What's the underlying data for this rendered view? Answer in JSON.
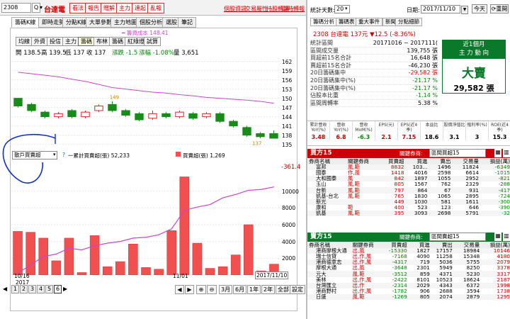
{
  "left": {
    "stock_code": "2308",
    "stock_name": "台達電",
    "red_tabs": [
      "看法",
      "報告",
      "贈解",
      "主力",
      "達起",
      "亂報"
    ],
    "top_links": [
      "個股資訊",
      "交易屬性",
      "持股轉讓",
      "即時轉報"
    ],
    "main_tabs": [
      "籌碼K線",
      "即時走勢",
      "分點K線",
      "大單參數",
      "主力地圖",
      "個股分析",
      "選股",
      "筆記"
    ],
    "sub_tabs": [
      "均線",
      "外資",
      "投信",
      "主力",
      "籌碼",
      "布林",
      "籌碼",
      "紅綠燈",
      "試算"
    ],
    "legend_line": "籌資成本 148.41",
    "ohlc": {
      "open": "開 138.5",
      "high": "高 139.5",
      "low": "低 137",
      "close": "收 137",
      "change": "漲跌 -1.5",
      "pct": "漲幅 -1.08%",
      "volume": "量 3,651"
    },
    "price_axis": [
      "162",
      "159",
      "156",
      "153",
      "150",
      "147",
      "144",
      "141",
      "138",
      "135"
    ],
    "candle_labels": {
      "hi": "149",
      "lo": "137"
    },
    "indicator_select": "散戶買賣超",
    "indicator_legend": {
      "a": "一累計買賣超(張) 52,233",
      "b": "買賣超(張) 1,269"
    },
    "indicator_value": "-361.4",
    "vol_axis": [
      "10000",
      "8000",
      "6000",
      "4000",
      "2000",
      "0"
    ],
    "x_labels": {
      "a": "10/16",
      "year": "2017",
      "b": "11/01",
      "c": "2017/11/10"
    },
    "pages": [
      "1",
      "2",
      "3",
      "4",
      "5",
      "6"
    ],
    "zoom_buttons": [
      "3月",
      "6月",
      "1年",
      "2年",
      "全部",
      "設定"
    ]
  },
  "right": {
    "stat_days_label": "統計天數:",
    "stat_days": "20",
    "date_label": "日期:",
    "date": "2017/11/10",
    "today_btn": "今天",
    "reload_btn": "重開",
    "tabs": [
      "籌碼分析",
      "籌碼表",
      "重大事件",
      "新聞",
      "分點細節"
    ],
    "quote": "2308 台達電 137元 ▼12.5 (-8.36%)",
    "rows": [
      {
        "label": "統計區間",
        "value": "20171016 ~ 2017111(",
        "cls": ""
      },
      {
        "label": "區間成交量",
        "value": "139,755 張",
        "cls": ""
      },
      {
        "label": "買超前15名合計",
        "value": "16,648 張",
        "cls": ""
      },
      {
        "label": "賣超前15名合計",
        "value": "-46,230 張",
        "cls": ""
      },
      {
        "label": "20日籌碼集中",
        "value": "-29,582 張",
        "cls": "red"
      },
      {
        "label": "20日籌碼集中(%)",
        "value": "-21.17 %",
        "cls": "green"
      },
      {
        "label": "20日籌碼集中(%)",
        "value": "-21.17 %",
        "cls": "green"
      },
      {
        "label": "佔股本比重",
        "value": "-1.14 %",
        "cls": "green"
      },
      {
        "label": "區間周轉率",
        "value": "5.38 %",
        "cls": ""
      }
    ],
    "trend_box": {
      "title1": "近1個月",
      "title2": "主 力 動 向",
      "big": "大賣",
      "amount": "29,582 張"
    },
    "metrics_headers": [
      "累計營收YoY(%)",
      "營收YoY(%)",
      "營收MoM(%)",
      "EPS(元)",
      "EPS(近4季)",
      "本益比",
      "股價淨值比",
      "殖利率(%)",
      "ROE(近4季)"
    ],
    "metrics_values": [
      "3.48",
      "6.8",
      "-6.3",
      "2.1",
      "7.15",
      "18.6",
      "3.1",
      "3",
      "15.3"
    ],
    "buy": {
      "title": "買方15",
      "filter_label": "關鍵券商:",
      "filter": "區間買超15",
      "headers": [
        "券商名稱",
        "關鍵券商",
        "買賣超",
        "買進",
        "賣出",
        "交易量",
        "損益(萬)"
      ],
      "rows": [
        [
          "富邦",
          "風,範",
          "8832",
          "103...",
          "1496",
          "11824",
          "-6349"
        ],
        [
          "國泰",
          "作,風",
          "1418",
          "4016",
          "2598",
          "6614",
          "-1015"
        ],
        [
          "大和國泰",
          "風",
          "842",
          "1897",
          "1055",
          "2952",
          "-821"
        ],
        [
          "玉山",
          "風,範",
          "805",
          "1567",
          "762",
          "2329",
          "-288"
        ],
        [
          "台新",
          "風,範",
          "797",
          "864",
          "67",
          "931",
          "-417"
        ],
        [
          "凱基-台北",
          "風,範",
          "765",
          "1830",
          "1065",
          "2895",
          "-724"
        ],
        [
          "新光",
          "",
          "449",
          "1030",
          "581",
          "1611",
          "-300"
        ],
        [
          "康和",
          "範",
          "400",
          "523",
          "123",
          "646",
          "-390"
        ],
        [
          "凱基",
          "風,範",
          "395",
          "3093",
          "2698",
          "5791",
          "-32"
        ]
      ]
    },
    "sell": {
      "title": "賣方15",
      "filter_label": "關鍵券商:",
      "filter": "區間賣超15",
      "headers": [
        "券商名稱",
        "關鍵券商",
        "買賣超",
        "買進",
        "賣出",
        "交易量",
        "損益(萬)"
      ],
      "rows": [
        [
          "港商摩根大通",
          "出,風",
          "-15330",
          "1827",
          "17157",
          "18984",
          "10146"
        ],
        [
          "瑞士信貸",
          "出,作,風",
          "-7168",
          "4090",
          "11258",
          "15348",
          "4180"
        ],
        [
          "港商德意志",
          "出,作,風",
          "-4317",
          "719",
          "5036",
          "5755",
          "2079"
        ],
        [
          "摩根大通",
          "出,風",
          "-3648",
          "2301",
          "5949",
          "8250",
          "3378"
        ],
        [
          "元大",
          "風,範",
          "-3512",
          "859",
          "4371",
          "5230",
          "3317"
        ],
        [
          "美林",
          "出,作,風",
          "-2422",
          "8101",
          "10523",
          "18624",
          "2187"
        ],
        [
          "台灣匯立",
          "出,作",
          "-2314",
          "2029",
          "4343",
          "6372",
          "1998"
        ],
        [
          "港商野村",
          "出,作,風",
          "-1782",
          "906",
          "2688",
          "3594",
          "1738"
        ],
        [
          "日盛",
          "風,範",
          "-1269",
          "805",
          "2074",
          "2879",
          "1295"
        ]
      ]
    }
  },
  "colors": {
    "down_candle": "#1a8a1a",
    "up_candle": "#e02020",
    "volume_bar": "#f05050",
    "cost_line": "#cc44cc"
  },
  "chart_data": [
    {
      "type": "candlestick",
      "x": [
        "10/16",
        "",
        "",
        "",
        "",
        "",
        "",
        "",
        "",
        "",
        "",
        "11/01",
        "",
        "",
        "",
        "",
        "",
        "",
        "",
        "2017/11/10"
      ],
      "candles": [
        {
          "o": 150,
          "c": 147.5,
          "h": 150,
          "l": 147
        },
        {
          "o": 148,
          "c": 146,
          "h": 148.5,
          "l": 145.5
        },
        {
          "o": 145.5,
          "c": 144,
          "h": 146,
          "l": 143.5
        },
        {
          "o": 144,
          "c": 145,
          "h": 145.5,
          "l": 143.5
        },
        {
          "o": 146,
          "c": 144,
          "h": 146.5,
          "l": 143.5
        },
        {
          "o": 144,
          "c": 145.5,
          "h": 146,
          "l": 143.5
        },
        {
          "o": 146,
          "c": 147.5,
          "h": 148,
          "l": 145.5
        },
        {
          "o": 148,
          "c": 146,
          "h": 149,
          "l": 145.5
        },
        {
          "o": 146,
          "c": 144.5,
          "h": 146.5,
          "l": 144
        },
        {
          "o": 145,
          "c": 143,
          "h": 145.5,
          "l": 142.5
        },
        {
          "o": 143.5,
          "c": 145,
          "h": 146,
          "l": 143
        },
        {
          "o": 145,
          "c": 144,
          "h": 145.5,
          "l": 143.5
        },
        {
          "o": 144,
          "c": 145.5,
          "h": 146,
          "l": 143.5
        },
        {
          "o": 145,
          "c": 143.5,
          "h": 145.5,
          "l": 143
        },
        {
          "o": 144,
          "c": 145,
          "h": 145.5,
          "l": 143.5
        },
        {
          "o": 145,
          "c": 142.5,
          "h": 145.5,
          "l": 142
        },
        {
          "o": 142.5,
          "c": 141,
          "h": 143,
          "l": 140.5
        },
        {
          "o": 140.5,
          "c": 138,
          "h": 141,
          "l": 137.5
        },
        {
          "o": 138.5,
          "c": 137.5,
          "h": 139,
          "l": 137
        },
        {
          "o": 138.5,
          "c": 137,
          "h": 139.5,
          "l": 137
        }
      ],
      "cost_line": [
        158.5,
        158,
        157.5,
        157,
        156.2,
        155.5,
        154.5,
        153.5,
        153,
        152.5,
        152,
        151.7,
        151.2,
        150.8,
        150.3,
        150,
        149.7,
        149.4,
        149,
        148.4
      ],
      "ylim": [
        134,
        164
      ]
    },
    {
      "type": "bar",
      "series": [
        {
          "name": "買賣超(張)",
          "values": [
            5200,
            5100,
            4400,
            1700,
            4400,
            300,
            4700,
            1000,
            1600,
            3700,
            900,
            700,
            5300,
            11700,
            3800,
            800,
            1000,
            2400,
            6000,
            500,
            1300
          ]
        }
      ],
      "line": [
        200,
        1200,
        2200,
        2500,
        3200,
        3000,
        3500,
        3800,
        4000,
        4400,
        4500,
        4800,
        5500,
        7700,
        8100,
        8400,
        9200,
        9600,
        10100,
        10200,
        10500
      ],
      "ylim": [
        0,
        12500
      ]
    }
  ]
}
